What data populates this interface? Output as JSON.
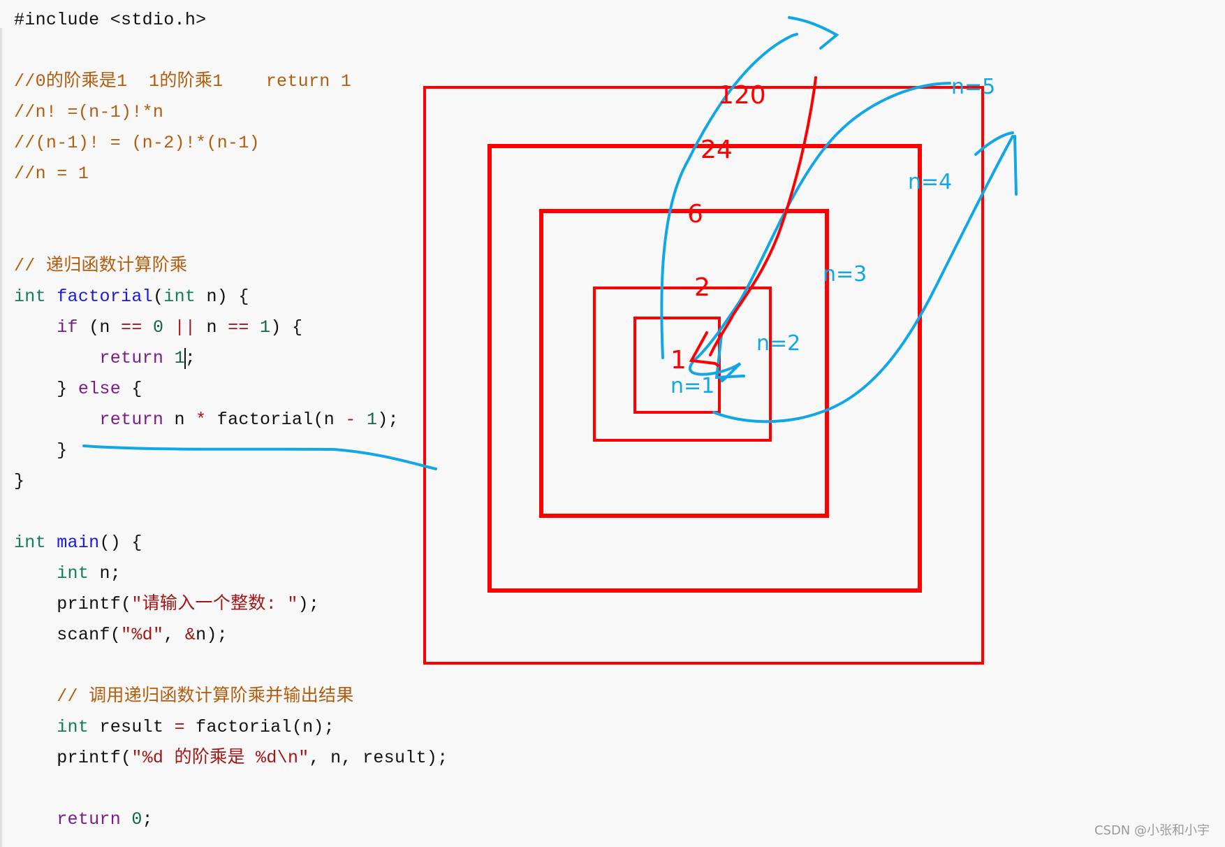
{
  "code": {
    "lines": [
      {
        "y": 0,
        "tokens": [
          {
            "t": "#include <stdio.h>",
            "c": "plain"
          }
        ]
      },
      {
        "y": 2,
        "tokens": [
          {
            "t": "//0的阶乘是1  1的阶乘1    return 1",
            "c": "comment"
          }
        ]
      },
      {
        "y": 3,
        "tokens": [
          {
            "t": "//n! =(n-1)!*n",
            "c": "comment"
          }
        ]
      },
      {
        "y": 4,
        "tokens": [
          {
            "t": "//(n-1)! = (n-2)!*(n-1)",
            "c": "comment"
          }
        ]
      },
      {
        "y": 5,
        "tokens": [
          {
            "t": "//n = 1",
            "c": "comment"
          }
        ]
      },
      {
        "y": 8,
        "tokens": [
          {
            "t": "// 递归函数计算阶乘",
            "c": "comment"
          }
        ]
      },
      {
        "y": 9,
        "tokens": [
          {
            "t": "int",
            "c": "type"
          },
          {
            "t": " ",
            "c": "plain"
          },
          {
            "t": "factorial",
            "c": "fn"
          },
          {
            "t": "(",
            "c": "plain"
          },
          {
            "t": "int",
            "c": "type"
          },
          {
            "t": " n) {",
            "c": "plain"
          }
        ]
      },
      {
        "y": 10,
        "tokens": [
          {
            "t": "    ",
            "c": "plain"
          },
          {
            "t": "if",
            "c": "kw"
          },
          {
            "t": " (n ",
            "c": "plain"
          },
          {
            "t": "==",
            "c": "op"
          },
          {
            "t": " ",
            "c": "plain"
          },
          {
            "t": "0",
            "c": "num"
          },
          {
            "t": " ",
            "c": "plain"
          },
          {
            "t": "||",
            "c": "op"
          },
          {
            "t": " n ",
            "c": "plain"
          },
          {
            "t": "==",
            "c": "op"
          },
          {
            "t": " ",
            "c": "plain"
          },
          {
            "t": "1",
            "c": "num"
          },
          {
            "t": ") {",
            "c": "plain"
          }
        ]
      },
      {
        "y": 11,
        "tokens": [
          {
            "t": "        ",
            "c": "plain"
          },
          {
            "t": "return",
            "c": "kw"
          },
          {
            "t": " ",
            "c": "plain"
          },
          {
            "t": "1",
            "c": "num"
          },
          {
            "t": "|",
            "c": "cursor"
          },
          {
            "t": ";",
            "c": "plain"
          }
        ]
      },
      {
        "y": 12,
        "tokens": [
          {
            "t": "    } ",
            "c": "plain"
          },
          {
            "t": "else",
            "c": "kw"
          },
          {
            "t": " {",
            "c": "plain"
          }
        ]
      },
      {
        "y": 13,
        "tokens": [
          {
            "t": "        ",
            "c": "plain"
          },
          {
            "t": "return",
            "c": "kw"
          },
          {
            "t": " n ",
            "c": "plain"
          },
          {
            "t": "*",
            "c": "op"
          },
          {
            "t": " factorial(n ",
            "c": "plain"
          },
          {
            "t": "-",
            "c": "op"
          },
          {
            "t": " ",
            "c": "plain"
          },
          {
            "t": "1",
            "c": "num"
          },
          {
            "t": ");",
            "c": "plain"
          }
        ]
      },
      {
        "y": 14,
        "tokens": [
          {
            "t": "    }",
            "c": "plain"
          }
        ]
      },
      {
        "y": 15,
        "tokens": [
          {
            "t": "}",
            "c": "plain"
          }
        ]
      },
      {
        "y": 17,
        "tokens": [
          {
            "t": "int",
            "c": "type"
          },
          {
            "t": " ",
            "c": "plain"
          },
          {
            "t": "main",
            "c": "fn"
          },
          {
            "t": "() {",
            "c": "plain"
          }
        ]
      },
      {
        "y": 18,
        "tokens": [
          {
            "t": "    ",
            "c": "plain"
          },
          {
            "t": "int",
            "c": "type"
          },
          {
            "t": " n;",
            "c": "plain"
          }
        ]
      },
      {
        "y": 19,
        "tokens": [
          {
            "t": "    printf(",
            "c": "plain"
          },
          {
            "t": "\"请输入一个整数: \"",
            "c": "str"
          },
          {
            "t": ");",
            "c": "plain"
          }
        ]
      },
      {
        "y": 20,
        "tokens": [
          {
            "t": "    scanf(",
            "c": "plain"
          },
          {
            "t": "\"%d\"",
            "c": "str"
          },
          {
            "t": ", ",
            "c": "plain"
          },
          {
            "t": "&",
            "c": "op"
          },
          {
            "t": "n);",
            "c": "plain"
          }
        ]
      },
      {
        "y": 22,
        "tokens": [
          {
            "t": "    // 调用递归函数计算阶乘并输出结果",
            "c": "comment"
          }
        ]
      },
      {
        "y": 23,
        "tokens": [
          {
            "t": "    ",
            "c": "plain"
          },
          {
            "t": "int",
            "c": "type"
          },
          {
            "t": " result ",
            "c": "plain"
          },
          {
            "t": "=",
            "c": "op"
          },
          {
            "t": " factorial(n);",
            "c": "plain"
          }
        ]
      },
      {
        "y": 24,
        "tokens": [
          {
            "t": "    printf(",
            "c": "plain"
          },
          {
            "t": "\"%d 的阶乘是 %d\\n\"",
            "c": "str"
          },
          {
            "t": ", n, result);",
            "c": "plain"
          }
        ]
      },
      {
        "y": 26,
        "tokens": [
          {
            "t": "    ",
            "c": "plain"
          },
          {
            "t": "return",
            "c": "kw"
          },
          {
            "t": " ",
            "c": "plain"
          },
          {
            "t": "0",
            "c": "num"
          },
          {
            "t": ";",
            "c": "plain"
          }
        ]
      }
    ]
  },
  "annotations": {
    "return_values": [
      "120",
      "24",
      "6",
      "2",
      "1"
    ],
    "call_labels": [
      "n=5",
      "n=4",
      "n=3",
      "n=2",
      "n=1"
    ]
  },
  "colors": {
    "annotation_red": "#ff0000",
    "annotation_blue": "#11a6e6"
  },
  "watermark": "CSDN @小张和小宇"
}
